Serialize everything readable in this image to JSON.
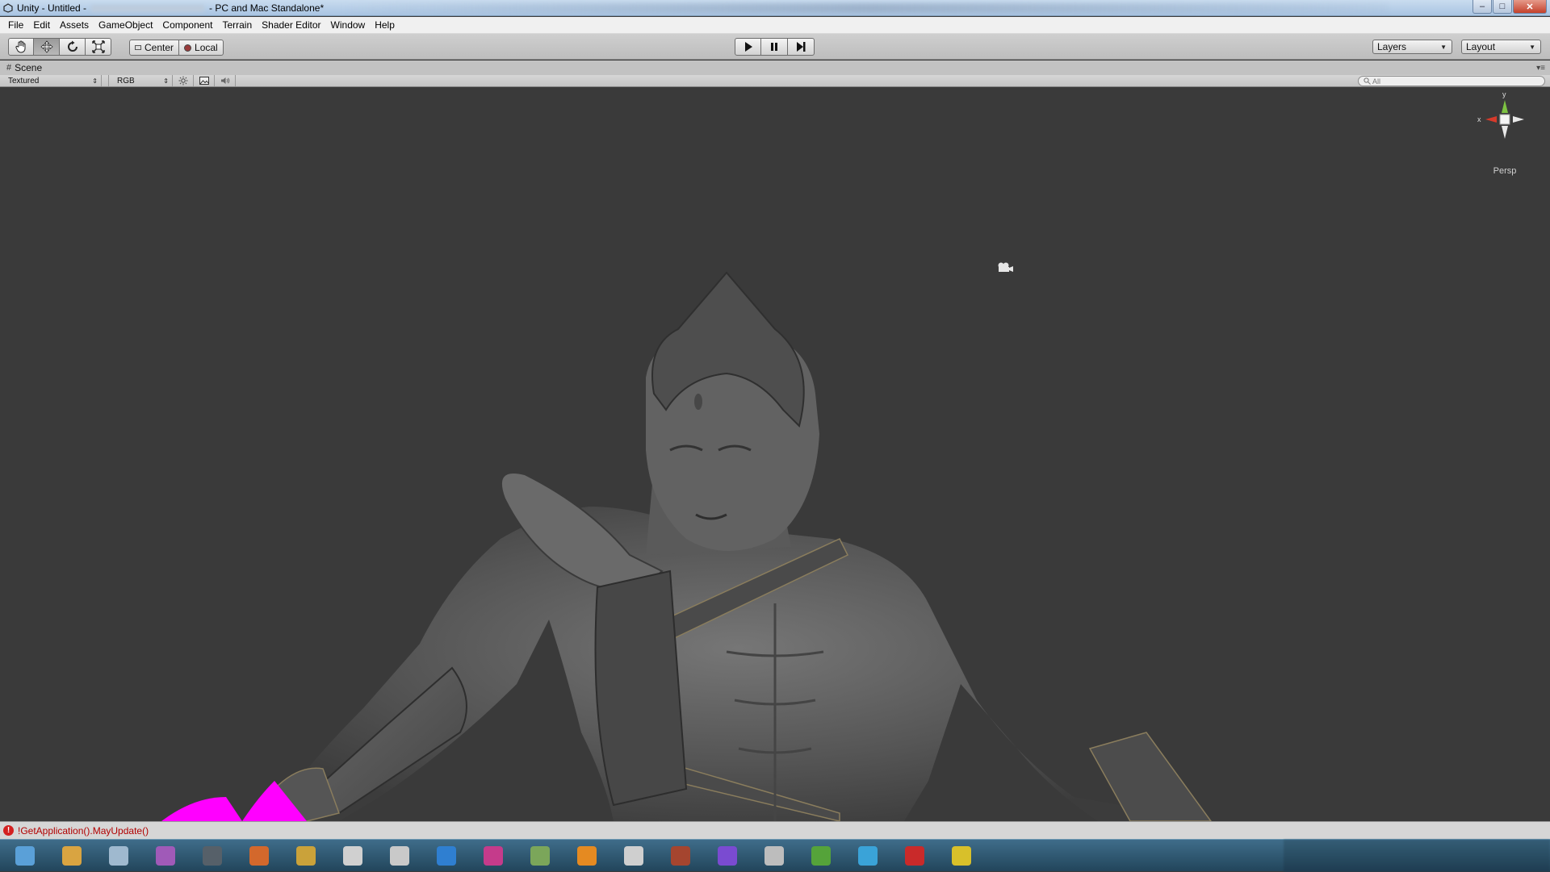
{
  "window": {
    "title_prefix": "Unity - Untitled -",
    "title_suffix": "- PC and Mac Standalone*",
    "controls": {
      "minimize": "–",
      "maximize": "□",
      "close": "✕"
    }
  },
  "menu": [
    "File",
    "Edit",
    "Assets",
    "GameObject",
    "Component",
    "Terrain",
    "Shader Editor",
    "Window",
    "Help"
  ],
  "toolbar": {
    "transform_tools": [
      {
        "name": "hand-tool",
        "icon": "hand-icon",
        "active": false
      },
      {
        "name": "move-tool",
        "icon": "move-icon",
        "active": true
      },
      {
        "name": "rotate-tool",
        "icon": "rotate-icon",
        "active": false
      },
      {
        "name": "scale-tool",
        "icon": "scale-icon",
        "active": false
      }
    ],
    "pivot_center": "Center",
    "pivot_local": "Local",
    "layers_label": "Layers",
    "layout_label": "Layout"
  },
  "scene": {
    "tab_label": "Scene",
    "render_mode": "Textured",
    "channel_mode": "RGB",
    "search_placeholder": "All",
    "persp_label": "Persp",
    "gizmo": {
      "y": "y",
      "x": "x"
    }
  },
  "status": {
    "message": "!GetApplication().MayUpdate()"
  },
  "colors": {
    "viewport_bg": "#3a3a3a",
    "missing_material": "#ff00ff",
    "error_text": "#b10000"
  },
  "taskbar": {
    "apps": [
      {
        "icon": "windows-start-icon",
        "color": "#5aa0d8"
      },
      {
        "icon": "folder-icon",
        "color": "#d9a441"
      },
      {
        "icon": "explorer-icon",
        "color": "#9fb9cf"
      },
      {
        "icon": "media-player-icon",
        "color": "#a05ab8"
      },
      {
        "icon": "app-icon",
        "color": "#566069"
      },
      {
        "icon": "firefox-icon",
        "color": "#d3682c"
      },
      {
        "icon": "app-icon",
        "color": "#caa23a"
      },
      {
        "icon": "app-icon",
        "color": "#d0d0d0"
      },
      {
        "icon": "app-icon",
        "color": "#c9c9c9"
      },
      {
        "icon": "app-icon",
        "color": "#2f7fd1"
      },
      {
        "icon": "app-icon",
        "color": "#c53b8b"
      },
      {
        "icon": "app-icon",
        "color": "#7ba65a"
      },
      {
        "icon": "app-icon",
        "color": "#e58a21"
      },
      {
        "icon": "app-icon",
        "color": "#cfcfcf"
      },
      {
        "icon": "app-icon",
        "color": "#a5452f"
      },
      {
        "icon": "app-icon",
        "color": "#7a4bd1"
      },
      {
        "icon": "app-icon",
        "color": "#bdbdbd"
      },
      {
        "icon": "app-icon",
        "color": "#55a33a"
      },
      {
        "icon": "app-icon",
        "color": "#3aa3d8"
      },
      {
        "icon": "app-icon",
        "color": "#c92a2a"
      },
      {
        "icon": "app-icon",
        "color": "#d8c02a"
      }
    ]
  }
}
